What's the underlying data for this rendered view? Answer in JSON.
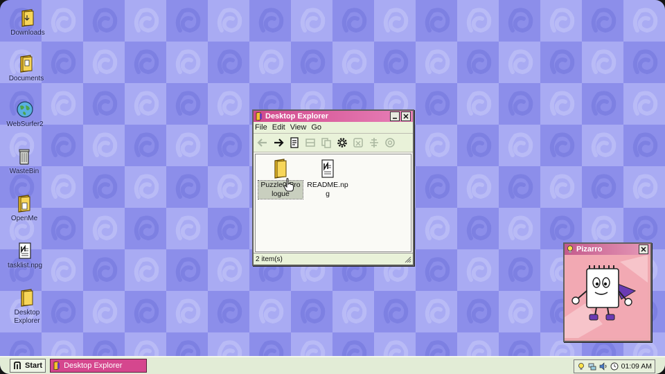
{
  "desktop": {
    "icons": [
      {
        "label": "Downloads",
        "icon": "folder-download-icon"
      },
      {
        "label": "Documents",
        "icon": "folder-documents-icon"
      },
      {
        "label": "WebSurfer2",
        "icon": "globe-icon"
      },
      {
        "label": "WasteBin",
        "icon": "trash-can-icon"
      },
      {
        "label": "OpenMe",
        "icon": "folder-document-icon"
      },
      {
        "label": "tasklist.npg",
        "icon": "notepad-icon"
      },
      {
        "label": "Desktop Explorer",
        "icon": "folder-explorer-icon"
      }
    ]
  },
  "explorer": {
    "title": "Desktop Explorer",
    "title_icon": "explorer-app-icon",
    "menu": [
      "File",
      "Edit",
      "View",
      "Go"
    ],
    "toolbar": [
      {
        "name": "back",
        "icon": "arrow-left-icon",
        "enabled": false
      },
      {
        "name": "forward",
        "icon": "arrow-right-icon",
        "enabled": true
      },
      {
        "name": "open",
        "icon": "document-view-icon",
        "enabled": true
      },
      {
        "name": "cut",
        "icon": "cut-icon",
        "enabled": false
      },
      {
        "name": "copy",
        "icon": "copy-icon",
        "enabled": false
      },
      {
        "name": "settings",
        "icon": "gear-icon",
        "enabled": true
      },
      {
        "name": "delete",
        "icon": "trash-icon",
        "enabled": false
      },
      {
        "name": "properties",
        "icon": "align-icon",
        "enabled": false
      },
      {
        "name": "refresh",
        "icon": "refresh-icon",
        "enabled": false
      }
    ],
    "files": [
      {
        "label_line1": "Puzzle0-Pro",
        "label_line2": "logue",
        "icon": "folder-icon",
        "selected": true
      },
      {
        "label_line1": "README.np",
        "label_line2": "g",
        "icon": "notepad-icon",
        "selected": false
      }
    ],
    "status": "2 item(s)"
  },
  "pizarro": {
    "title": "Pizarro",
    "title_icon": "lightbulb-icon",
    "character": "calendar-mascot-illustration"
  },
  "taskbar": {
    "start_label": "Start",
    "start_icon": "start-logo-icon",
    "tasks": [
      {
        "label": "Desktop Explorer",
        "icon": "explorer-app-icon"
      }
    ],
    "tray_icons": [
      "lightbulb-icon",
      "network-icon",
      "volume-icon",
      "clock-icon"
    ],
    "time": "01:09 AM"
  },
  "colors": {
    "wallpaper_dark": "#8c8eea",
    "wallpaper_light": "#a9abf3",
    "title_active": "#d14a8c",
    "taskbar": "#e2ecd6"
  }
}
